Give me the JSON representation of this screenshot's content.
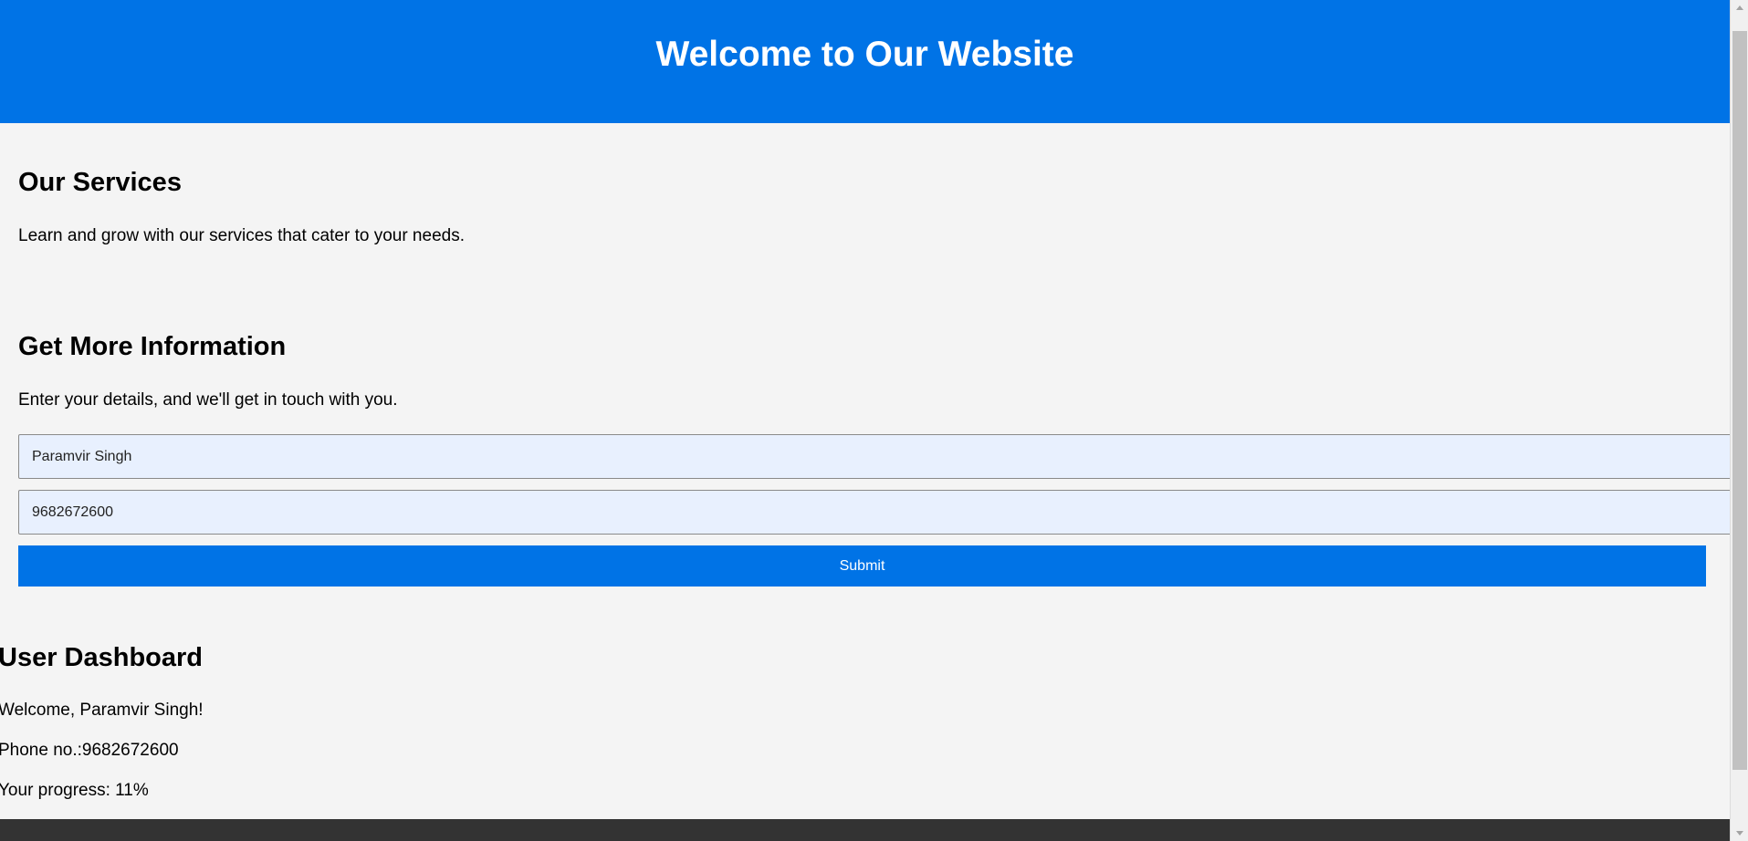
{
  "header": {
    "title": "Welcome to Our Website"
  },
  "services": {
    "heading": "Our Services",
    "description": "Learn and grow with our services that cater to your needs."
  },
  "info_form": {
    "heading": "Get More Information",
    "description": "Enter your details, and we'll get in touch with you.",
    "name_value": "Paramvir Singh",
    "phone_value": "9682672600",
    "submit_label": "Submit"
  },
  "dashboard": {
    "heading": "User Dashboard",
    "welcome": "Welcome, Paramvir Singh!",
    "phone": "Phone no.:9682672600",
    "progress": "Your progress: 11%"
  },
  "colors": {
    "brand": "#0073e6",
    "background": "#f4f4f4",
    "input_fill": "#e8f0fe",
    "footer": "#333333"
  }
}
